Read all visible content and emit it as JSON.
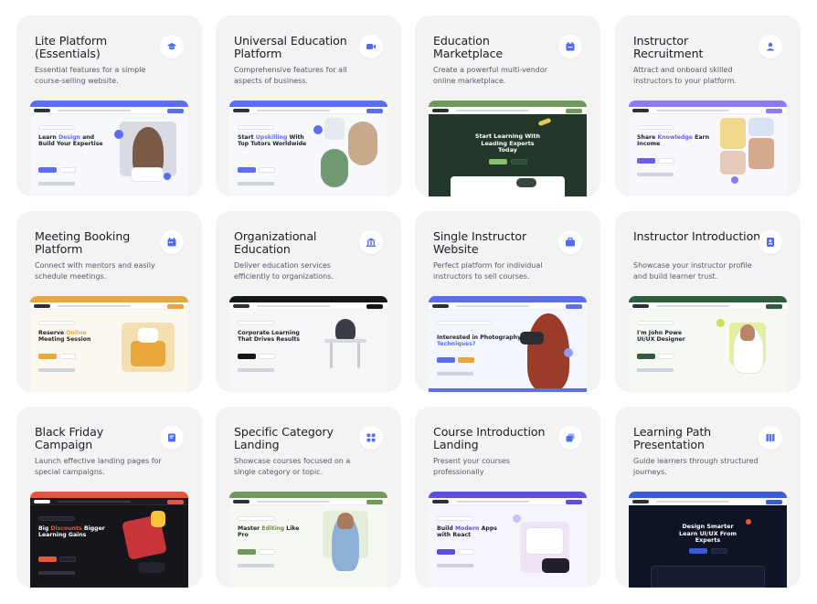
{
  "cards": [
    {
      "title": "Lite Platform (Essentials)",
      "desc": "Essential features for a simple course-selling website.",
      "icon": "graduation-cap-icon",
      "accent": "#5b6cf5",
      "headline": [
        "Learn ",
        "Design",
        " and Build Your Expertise"
      ]
    },
    {
      "title": "Universal Education Platform",
      "desc": "Comprehensive features for all aspects of business.",
      "icon": "video-icon",
      "accent": "#5b6cf5",
      "headline": [
        "Start ",
        "Upskilling",
        " With Top Tutors Worldwide"
      ]
    },
    {
      "title": "Education Marketplace",
      "desc": "Create a powerful multi-vendor online marketplace.",
      "icon": "calendar-store-icon",
      "accent": "#6f9a5a",
      "headline": [
        "",
        "",
        "Start Learning With Leading Experts Today"
      ]
    },
    {
      "title": "Instructor Recruitment",
      "desc": "Attract and onboard skilled instructors to your platform.",
      "icon": "user-icon",
      "accent": "#8b7cf6",
      "headline": [
        "Share ",
        "Knowledge",
        " Earn Income"
      ]
    },
    {
      "title": "Meeting Booking Platform",
      "desc": "Connect with mentors and easily schedule meetings.",
      "icon": "calendar-icon",
      "accent": "#e8a63b",
      "headline": [
        "Reserve ",
        "Online",
        " Meeting Session"
      ]
    },
    {
      "title": "Organizational Education",
      "desc": "Deliver education services efficiently to organizations.",
      "icon": "building-icon",
      "accent": "#15161a",
      "headline": [
        "",
        "",
        "Corporate Learning That Drives Results"
      ]
    },
    {
      "title": "Single Instructor Website",
      "desc": "Perfect platform for individual instructors to sell courses.",
      "icon": "briefcase-icon",
      "accent": "#5b6cf5",
      "headline": [
        "Interested in Photography ",
        "Techniques?",
        ""
      ]
    },
    {
      "title": "Instructor Introduction",
      "desc": "Showcase your instructor profile and build learner trust.",
      "icon": "id-card-icon",
      "accent": "#2f5c3d",
      "headline": [
        "I'm John Powe UI/UX Designer",
        "",
        ""
      ]
    },
    {
      "title": "Black Friday Campaign",
      "desc": "Launch effective landing pages for special campaigns.",
      "icon": "tag-icon",
      "accent": "#e8553f",
      "headline": [
        "Big ",
        "Discounts",
        " Bigger Learning Gains"
      ]
    },
    {
      "title": "Specific Category Landing",
      "desc": "Showcase courses focused on a single category or topic.",
      "icon": "grid-icon",
      "accent": "#6f9a5a",
      "headline": [
        "Master ",
        "Editing",
        " Like Pro"
      ]
    },
    {
      "title": "Course Introduction Landing",
      "desc": "Present your courses professionally",
      "icon": "layers-icon",
      "accent": "#5b4de6",
      "headline": [
        "Build ",
        "Modern",
        " Apps with React"
      ]
    },
    {
      "title": "Learning Path Presentation",
      "desc": "Guide learners through structured journeys.",
      "icon": "map-icon",
      "accent": "#3b5bd9",
      "headline": [
        "",
        "",
        "Design Smarter Learn UI/UX From Experts"
      ]
    }
  ]
}
